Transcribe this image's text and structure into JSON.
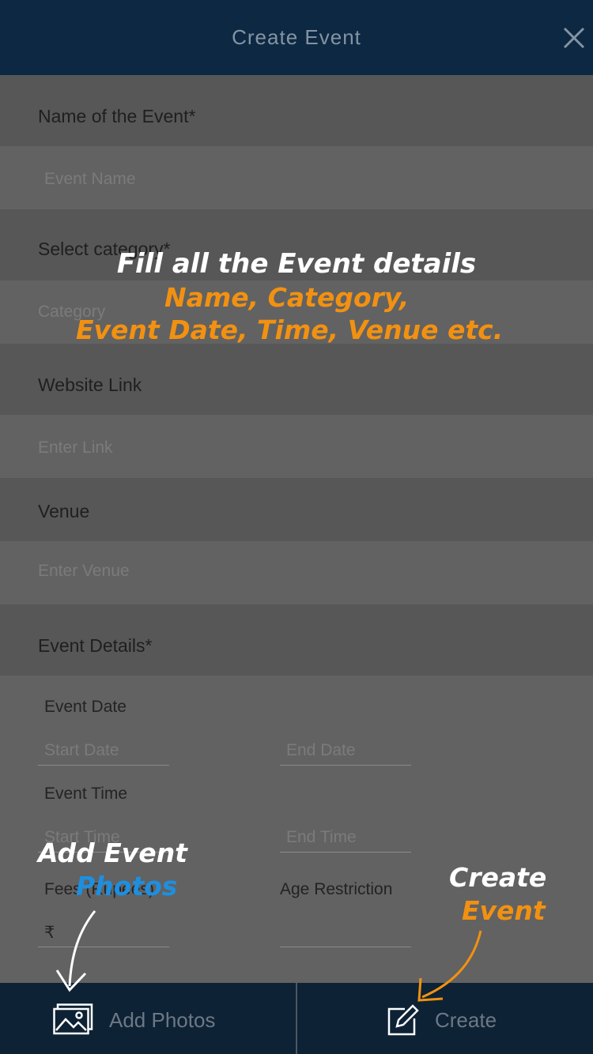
{
  "header": {
    "title": "Create Event",
    "close_icon": "close-icon"
  },
  "form": {
    "name_label": "Name of the Event*",
    "name_placeholder": "Event Name",
    "category_label": "Select category*",
    "category_placeholder": "Category",
    "website_label": "Website Link",
    "website_placeholder": "Enter Link",
    "venue_label": "Venue",
    "venue_placeholder": "Enter Venue",
    "details_label": "Event Details*",
    "event_date_label": "Event Date",
    "start_date_placeholder": "Start Date",
    "end_date_placeholder": "End Date",
    "event_time_label": "Event Time",
    "start_time_placeholder": "Start Time",
    "end_time_placeholder": "End Time",
    "fees_label": "Fees (Rupees)",
    "currency_symbol": "₹",
    "age_label": "Age Restriction"
  },
  "bottom_bar": {
    "add_photos_label": "Add Photos",
    "create_label": "Create"
  },
  "overlay": {
    "main_line": "Fill all the Event details",
    "orange_line_1": "Name, Category,",
    "orange_line_2": "Event Date, Time, Venue etc.",
    "add_event_white": "Add Event",
    "add_event_blue": "Photos",
    "create_white": "Create",
    "create_orange": "Event"
  },
  "colors": {
    "header_bg": "#0d2842",
    "overlay_white": "#ffffff",
    "overlay_orange": "#f29111",
    "overlay_blue": "#1d8fe0"
  }
}
